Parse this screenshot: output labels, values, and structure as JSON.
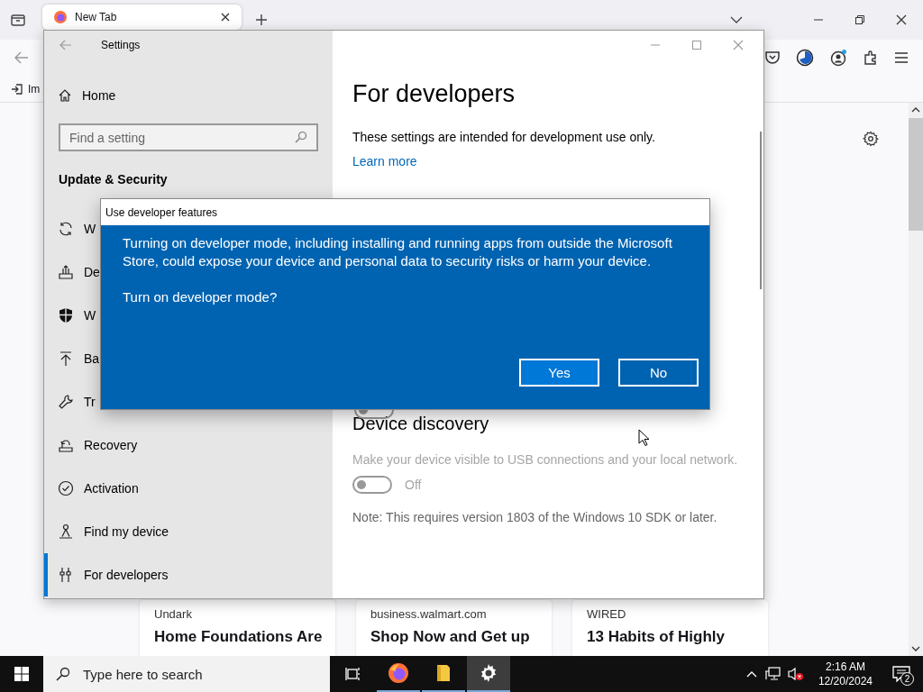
{
  "browser": {
    "tabs": [
      {
        "title": "New Tab",
        "selected": true
      }
    ],
    "bookmarks": [
      {
        "label": "Im"
      }
    ],
    "cards": [
      {
        "source": "Undark",
        "title": "Home Foundations Are"
      },
      {
        "source": "business.walmart.com",
        "title": "Shop Now and Get up"
      },
      {
        "source": "WIRED",
        "title": "13 Habits of Highly"
      }
    ]
  },
  "settings_window": {
    "title": "Settings",
    "nav": {
      "home": "Home",
      "search_placeholder": "Find a setting",
      "section": "Update & Security",
      "items": [
        {
          "label": "W",
          "kind": "sync",
          "selected": false
        },
        {
          "label": "De",
          "kind": "delivery",
          "selected": false
        },
        {
          "label": "W",
          "kind": "shield",
          "selected": false
        },
        {
          "label": "Ba",
          "kind": "backup",
          "selected": false
        },
        {
          "label": "Tr",
          "kind": "wrench",
          "selected": false
        },
        {
          "label": "Recovery",
          "kind": "recovery",
          "selected": false
        },
        {
          "label": "Activation",
          "kind": "activation",
          "selected": false
        },
        {
          "label": "Find my device",
          "kind": "find",
          "selected": false
        },
        {
          "label": "For developers",
          "kind": "developers",
          "selected": true
        }
      ]
    },
    "page": {
      "title": "For developers",
      "intro": "These settings are intended for development use only.",
      "link": "Learn more",
      "covered_toggle": {
        "on": false
      },
      "sections": [
        {
          "heading": "Device discovery",
          "description": "Make your device visible to USB connections and your local network.",
          "disabled": true,
          "toggle": {
            "on": false,
            "label": "Off"
          },
          "note": "Note: This requires version 1803 of the Windows 10 SDK or later."
        }
      ]
    }
  },
  "dialog": {
    "title": "Use developer features",
    "message": "Turning on developer mode, including installing and running apps from outside the Microsoft Store, could expose your device and personal data to security risks or harm your device.",
    "question": "Turn on developer mode?",
    "buttons": [
      {
        "label": "Yes",
        "selected": true
      },
      {
        "label": "No",
        "selected": false
      }
    ]
  },
  "taskbar": {
    "search_placeholder": "Type here to search",
    "apps": [
      {
        "kind": "task-view",
        "running": false,
        "active": false
      },
      {
        "kind": "firefox",
        "running": true,
        "active": false
      },
      {
        "kind": "files",
        "running": true,
        "active": false
      },
      {
        "kind": "settings",
        "running": true,
        "active": true
      }
    ],
    "clock": {
      "time": "2:16 AM",
      "date": "12/20/2024"
    },
    "notifications": "2"
  }
}
